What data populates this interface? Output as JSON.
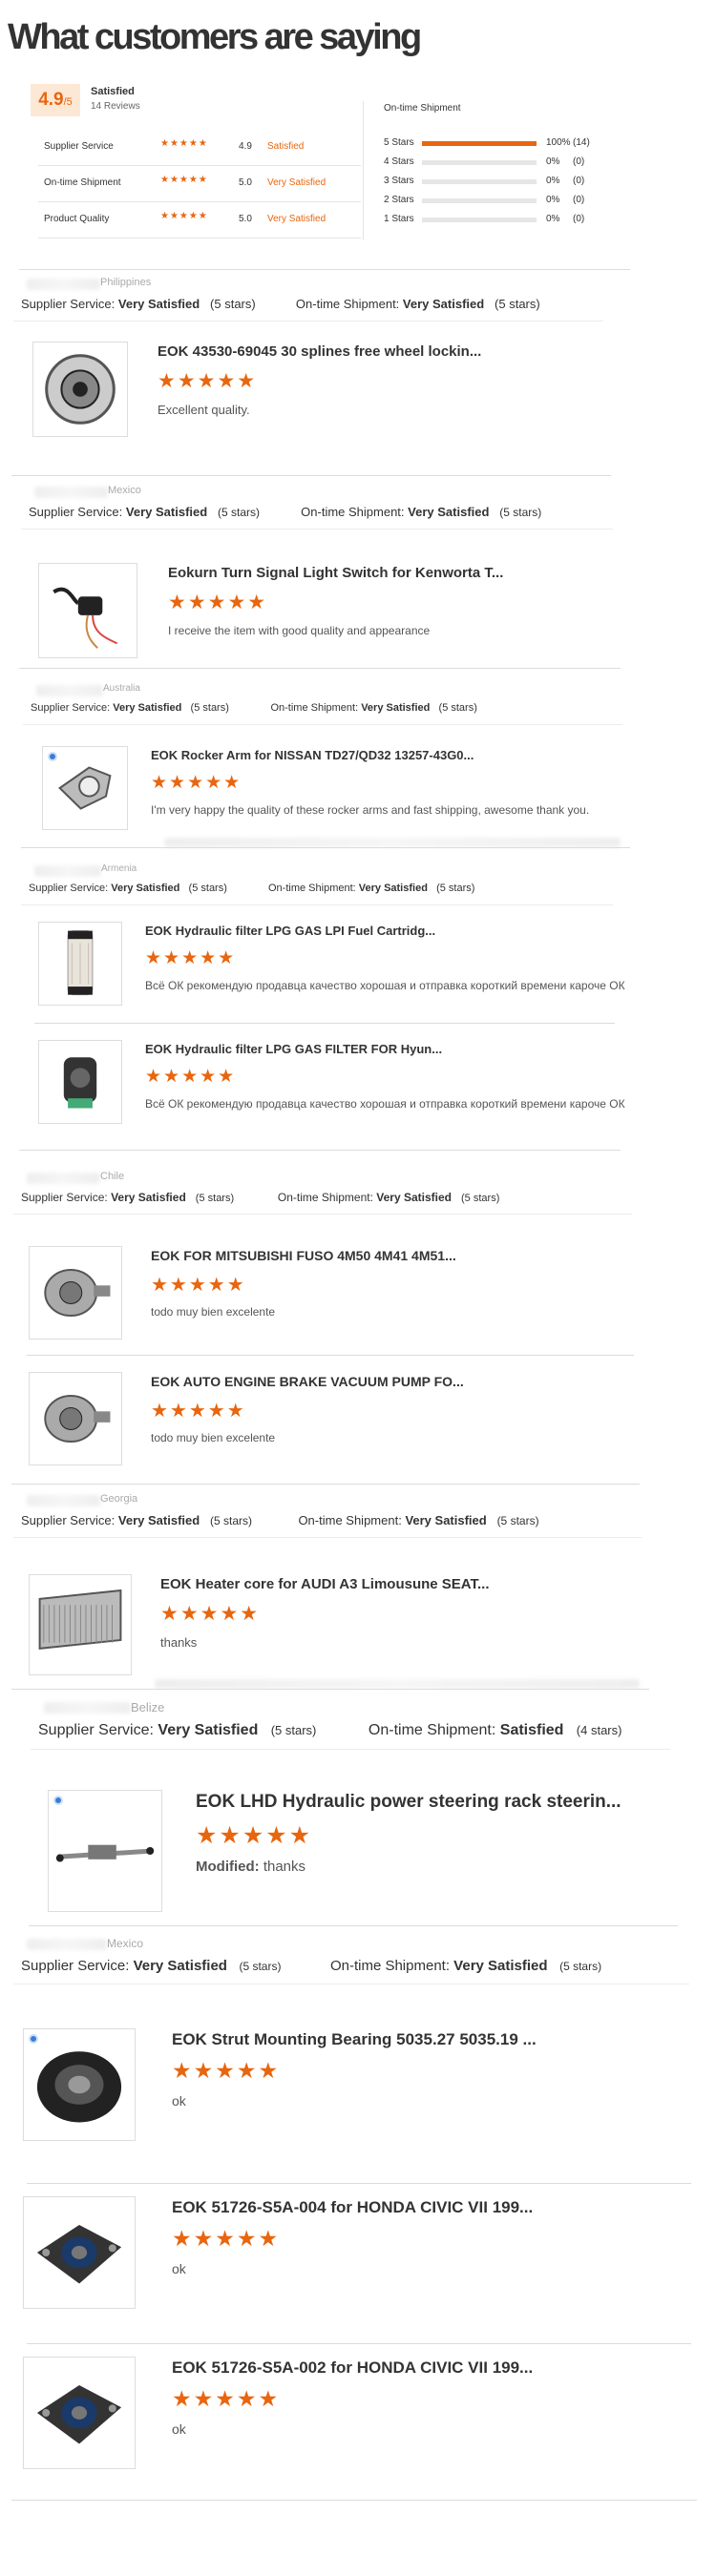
{
  "header": {
    "title": "What customers are saying"
  },
  "summary": {
    "score": "4.9",
    "score_suffix": "/5",
    "label": "Satisfied",
    "reviews": "14 Reviews",
    "rows": [
      {
        "label": "Supplier Service",
        "value": "4.9",
        "text": "Satisfied"
      },
      {
        "label": "On-time Shipment",
        "value": "5.0",
        "text": "Very Satisfied"
      },
      {
        "label": "Product Quality",
        "value": "5.0",
        "text": "Very Satisfied"
      }
    ]
  },
  "shipment": {
    "title": "On-time Shipment",
    "bars": [
      {
        "label": "5 Stars",
        "fraction": 1.0,
        "pct": "100%",
        "count": "(14)"
      },
      {
        "label": "4 Stars",
        "fraction": 0,
        "pct": "0%",
        "count": "(0)"
      },
      {
        "label": "3 Stars",
        "fraction": 0,
        "pct": "0%",
        "count": "(0)"
      },
      {
        "label": "2 Stars",
        "fraction": 0,
        "pct": "0%",
        "count": "(0)"
      },
      {
        "label": "1 Stars",
        "fraction": 0,
        "pct": "0%",
        "count": "(0)"
      }
    ]
  },
  "common": {
    "supplier_label": "Supplier Service:",
    "shipment_label": "On-time Shipment:",
    "very_satisfied": "Very Satisfied",
    "satisfied": "Satisfied",
    "five_stars": "(5 stars)",
    "four_stars": "(4 stars)",
    "stars": "★★★★★",
    "modified": "Modified:"
  },
  "reviews": [
    {
      "country": "Philippines",
      "shipment_text": "Very Satisfied",
      "shipment_stars": "(5 stars)",
      "products": [
        {
          "title": "EOK 43530-69045 30 splines free wheel lockin...",
          "comment": "Excellent quality."
        }
      ]
    },
    {
      "country": "Mexico",
      "shipment_text": "Very Satisfied",
      "shipment_stars": "(5 stars)",
      "products": [
        {
          "title": "Eokurn Turn Signal Light Switch for Kenworta T...",
          "comment": "I receive the item with good quality and appearance"
        }
      ]
    },
    {
      "country": "Australia",
      "shipment_text": "Very Satisfied",
      "shipment_stars": "(5 stars)",
      "products": [
        {
          "title": "EOK Rocker Arm for NISSAN TD27/QD32 13257-43G0...",
          "comment": "I'm very happy the quality of these rocker arms and fast shipping, awesome thank you."
        }
      ]
    },
    {
      "country": "Armenia",
      "shipment_text": "Very Satisfied",
      "shipment_stars": "(5 stars)",
      "products": [
        {
          "title": "EOK Hydraulic filter LPG GAS LPI Fuel Cartridg...",
          "comment": "Всё ОК рекомендую продавца качество хорошая и отправка  короткий времени кароче ОК"
        },
        {
          "title": "EOK Hydraulic filter LPG GAS FILTER FOR Hyun...",
          "comment": "Всё ОК рекомендую продавца качество хорошая и отправка  короткий времени кароче ОК"
        }
      ]
    },
    {
      "country": "Chile",
      "shipment_text": "Very Satisfied",
      "shipment_stars": "(5 stars)",
      "products": [
        {
          "title": "EOK FOR MITSUBISHI FUSO 4M50 4M41 4M51...",
          "comment": "todo muy bien excelente"
        },
        {
          "title": "EOK AUTO ENGINE BRAKE VACUUM PUMP FO...",
          "comment": "todo muy bien excelente"
        }
      ]
    },
    {
      "country": "Georgia",
      "shipment_text": "Very Satisfied",
      "shipment_stars": "(5 stars)",
      "products": [
        {
          "title": "EOK Heater core for AUDI A3 Limousune SEAT...",
          "comment": "thanks"
        }
      ]
    },
    {
      "country": "Belize",
      "shipment_text": "Satisfied",
      "shipment_stars": "(4 stars)",
      "products": [
        {
          "title": "EOK LHD Hydraulic power steering rack steerin...",
          "comment": "thanks",
          "modified": true
        }
      ]
    },
    {
      "country": "Mexico",
      "shipment_text": "Very Satisfied",
      "shipment_stars": "(5 stars)",
      "products": [
        {
          "title": "EOK Strut Mounting Bearing 5035.27 5035.19 ...",
          "comment": "ok"
        },
        {
          "title": "EOK 51726-S5A-004 for HONDA CIVIC VII 199...",
          "comment": "ok"
        },
        {
          "title": "EOK 51726-S5A-002 for HONDA CIVIC VII 199...",
          "comment": "ok"
        }
      ]
    }
  ]
}
